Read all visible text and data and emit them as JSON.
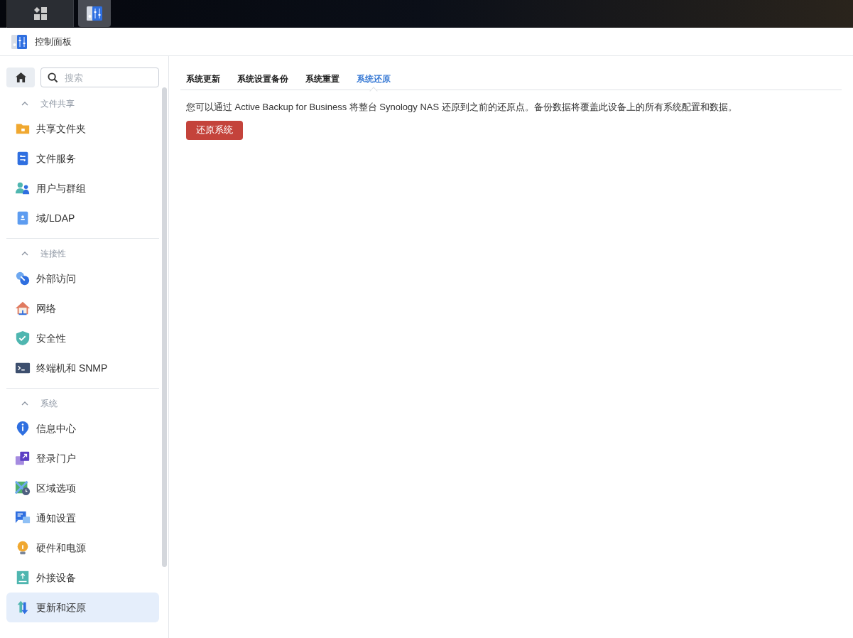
{
  "window": {
    "title": "控制面板"
  },
  "sidebar": {
    "search": {
      "placeholder": "搜索"
    },
    "sections": [
      {
        "title": "文件共享",
        "expanded": true,
        "items": [
          {
            "label": "共享文件夹",
            "selected": false
          },
          {
            "label": "文件服务",
            "selected": false
          },
          {
            "label": "用户与群组",
            "selected": false
          },
          {
            "label": "域/LDAP",
            "selected": false
          }
        ]
      },
      {
        "title": "连接性",
        "expanded": true,
        "items": [
          {
            "label": "外部访问",
            "selected": false
          },
          {
            "label": "网络",
            "selected": false
          },
          {
            "label": "安全性",
            "selected": false
          },
          {
            "label": "终端机和 SNMP",
            "selected": false
          }
        ]
      },
      {
        "title": "系统",
        "expanded": true,
        "items": [
          {
            "label": "信息中心",
            "selected": false
          },
          {
            "label": "登录门户",
            "selected": false
          },
          {
            "label": "区域选项",
            "selected": false
          },
          {
            "label": "通知设置",
            "selected": false
          },
          {
            "label": "硬件和电源",
            "selected": false
          },
          {
            "label": "外接设备",
            "selected": false
          },
          {
            "label": "更新和还原",
            "selected": true
          }
        ]
      }
    ]
  },
  "tabs": [
    {
      "label": "系统更新",
      "selected": false
    },
    {
      "label": "系统设置备份",
      "selected": false
    },
    {
      "label": "系统重置",
      "selected": false
    },
    {
      "label": "系统还原",
      "selected": true
    }
  ],
  "content": {
    "description": "您可以通过 Active Backup for Business 将整台 Synology NAS 还原到之前的还原点。备份数据将覆盖此设备上的所有系统配置和数据。",
    "button": "还原系统"
  }
}
